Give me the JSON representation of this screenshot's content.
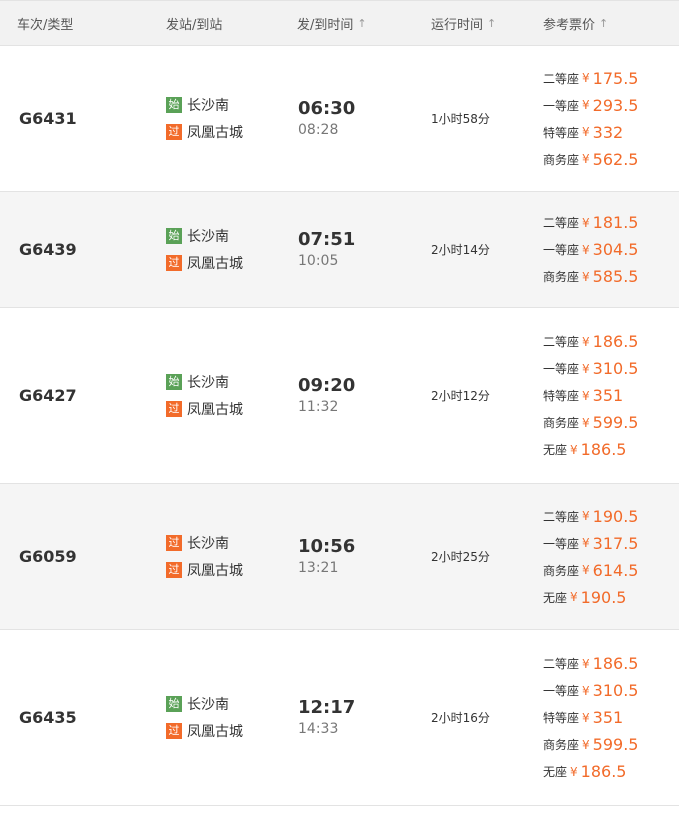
{
  "header": {
    "train_type": "车次/类型",
    "stations": "发站/到站",
    "time": "发/到时间",
    "duration": "运行时间",
    "price": "参考票价"
  },
  "trains": [
    {
      "number": "G6431",
      "from_tag": "始",
      "from": "长沙南",
      "to_tag": "过",
      "to": "凤凰古城",
      "depart": "06:30",
      "arrive": "08:28",
      "duration": "1小时58分",
      "prices": [
        {
          "seat": "二等座",
          "yen": "¥",
          "price": "175.5"
        },
        {
          "seat": "一等座",
          "yen": "¥",
          "price": "293.5"
        },
        {
          "seat": "特等座",
          "yen": "¥",
          "price": "332"
        },
        {
          "seat": "商务座",
          "yen": "¥",
          "price": "562.5"
        }
      ]
    },
    {
      "number": "G6439",
      "from_tag": "始",
      "from": "长沙南",
      "to_tag": "过",
      "to": "凤凰古城",
      "depart": "07:51",
      "arrive": "10:05",
      "duration": "2小时14分",
      "prices": [
        {
          "seat": "二等座",
          "yen": "¥",
          "price": "181.5"
        },
        {
          "seat": "一等座",
          "yen": "¥",
          "price": "304.5"
        },
        {
          "seat": "商务座",
          "yen": "¥",
          "price": "585.5"
        }
      ]
    },
    {
      "number": "G6427",
      "from_tag": "始",
      "from": "长沙南",
      "to_tag": "过",
      "to": "凤凰古城",
      "depart": "09:20",
      "arrive": "11:32",
      "duration": "2小时12分",
      "prices": [
        {
          "seat": "二等座",
          "yen": "¥",
          "price": "186.5"
        },
        {
          "seat": "一等座",
          "yen": "¥",
          "price": "310.5"
        },
        {
          "seat": "特等座",
          "yen": "¥",
          "price": "351"
        },
        {
          "seat": "商务座",
          "yen": "¥",
          "price": "599.5"
        },
        {
          "seat": "无座",
          "yen": "¥",
          "price": "186.5"
        }
      ]
    },
    {
      "number": "G6059",
      "from_tag": "过",
      "from": "长沙南",
      "to_tag": "过",
      "to": "凤凰古城",
      "depart": "10:56",
      "arrive": "13:21",
      "duration": "2小时25分",
      "prices": [
        {
          "seat": "二等座",
          "yen": "¥",
          "price": "190.5"
        },
        {
          "seat": "一等座",
          "yen": "¥",
          "price": "317.5"
        },
        {
          "seat": "商务座",
          "yen": "¥",
          "price": "614.5"
        },
        {
          "seat": "无座",
          "yen": "¥",
          "price": "190.5"
        }
      ]
    },
    {
      "number": "G6435",
      "from_tag": "始",
      "from": "长沙南",
      "to_tag": "过",
      "to": "凤凰古城",
      "depart": "12:17",
      "arrive": "14:33",
      "duration": "2小时16分",
      "prices": [
        {
          "seat": "二等座",
          "yen": "¥",
          "price": "186.5"
        },
        {
          "seat": "一等座",
          "yen": "¥",
          "price": "310.5"
        },
        {
          "seat": "特等座",
          "yen": "¥",
          "price": "351"
        },
        {
          "seat": "商务座",
          "yen": "¥",
          "price": "599.5"
        },
        {
          "seat": "无座",
          "yen": "¥",
          "price": "186.5"
        }
      ]
    }
  ]
}
